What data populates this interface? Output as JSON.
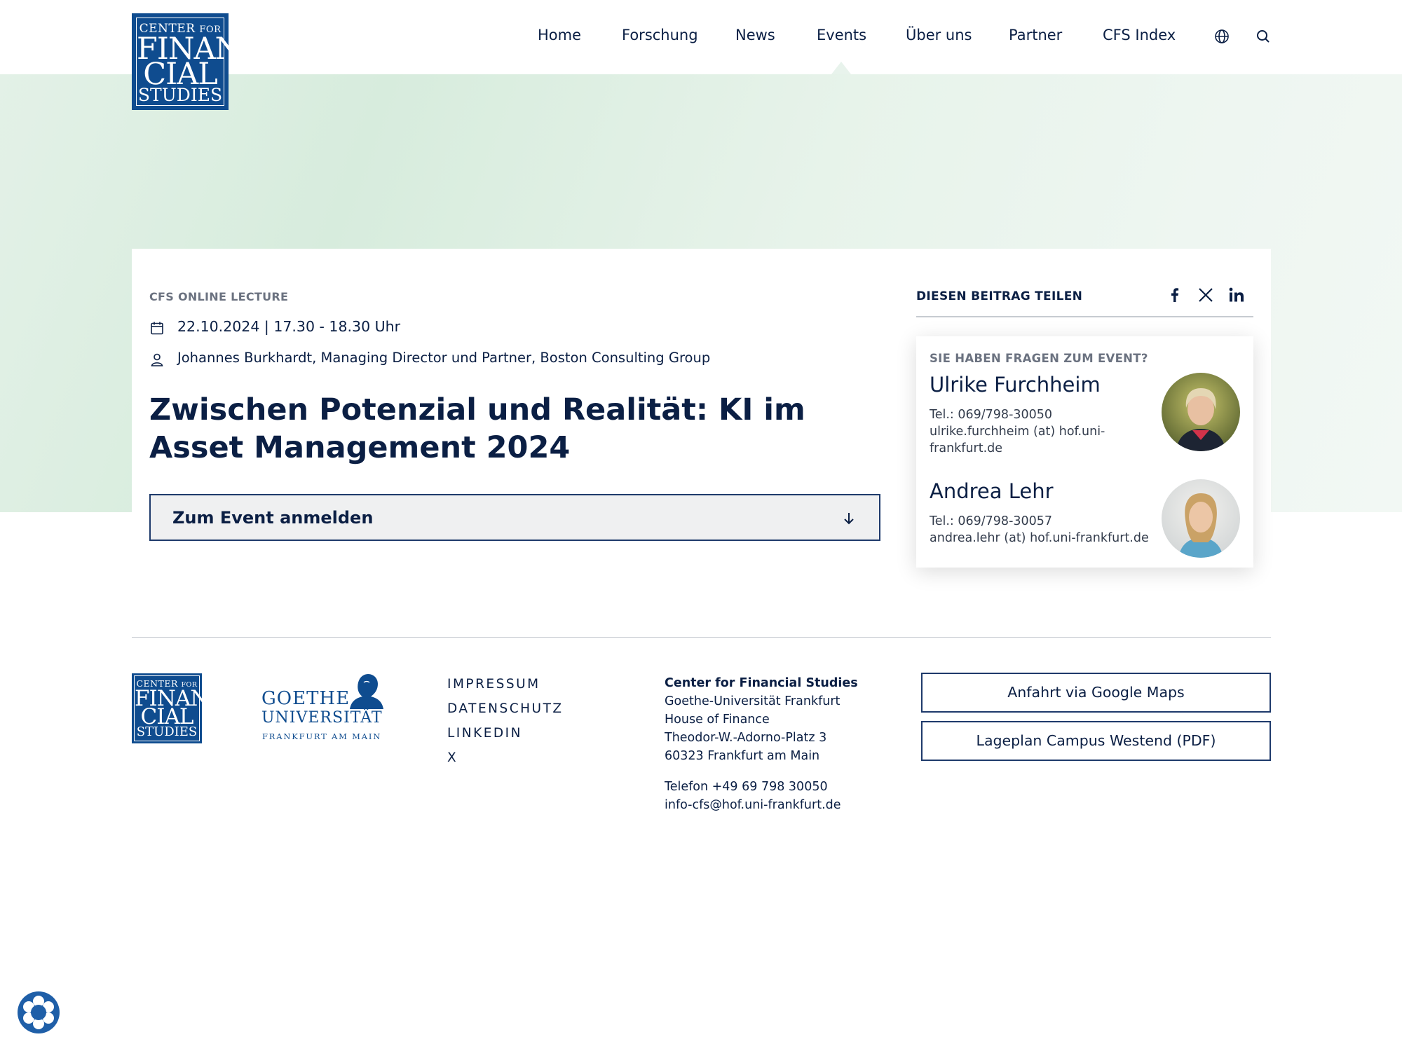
{
  "logo": {
    "line1": "CENTER",
    "line1_small": "FOR",
    "line2": "FINAN",
    "line3": "CIAL",
    "line4": "STUDIES"
  },
  "nav": {
    "items": [
      {
        "label": "Home"
      },
      {
        "label": "Forschung"
      },
      {
        "label": "News"
      },
      {
        "label": "Events"
      },
      {
        "label": "Über uns"
      },
      {
        "label": "Partner"
      },
      {
        "label": "CFS Index"
      }
    ],
    "active": "Events",
    "icons": [
      "globe-icon",
      "search-icon"
    ]
  },
  "event": {
    "category": "CFS ONLINE LECTURE",
    "datetime": "22.10.2024 | 17.30 - 18.30 Uhr",
    "speaker": "Johannes Burkhardt, Managing Director und Partner, Boston Consulting Group",
    "title": "Zwischen Potenzial und Realität: KI im Asset Management 2024",
    "register_label": "Zum Event anmelden"
  },
  "share": {
    "label": "DIESEN BEITRAG TEILEN",
    "icons": [
      "facebook-icon",
      "x-icon",
      "linkedin-icon"
    ]
  },
  "contact": {
    "heading": "SIE HABEN FRAGEN ZUM EVENT?",
    "people": [
      {
        "name": "Ulrike Furchheim",
        "phone": "Tel.: 069/798-30050",
        "email_l1": "ulrike.furchheim (at) hof.uni-",
        "email_l2": "frankfurt.de"
      },
      {
        "name": "Andrea Lehr",
        "phone": "Tel.: 069/798-30057",
        "email_l1": "andrea.lehr (at) hof.uni-frankfurt.de",
        "email_l2": ""
      }
    ]
  },
  "footer": {
    "goethe": {
      "line1": "GOETHE",
      "line2": "UNIVERSITÄT",
      "line3": "FRANKFURT AM MAIN"
    },
    "links": [
      "IMPRESSUM",
      "DATENSCHUTZ",
      "LINKEDIN",
      "X"
    ],
    "address": {
      "name": "Center for Financial Studies",
      "lines": [
        "Goethe-Universität Frankfurt",
        "House of Finance",
        "Theodor-W.-Adorno-Platz 3",
        "60323 Frankfurt am Main"
      ],
      "phone": "Telefon +49 69 798 30050",
      "email": "info-cfs@hof.uni-frankfurt.de"
    },
    "buttons": [
      "Anfahrt via Google Maps",
      "Lageplan Campus Westend (PDF)"
    ]
  }
}
